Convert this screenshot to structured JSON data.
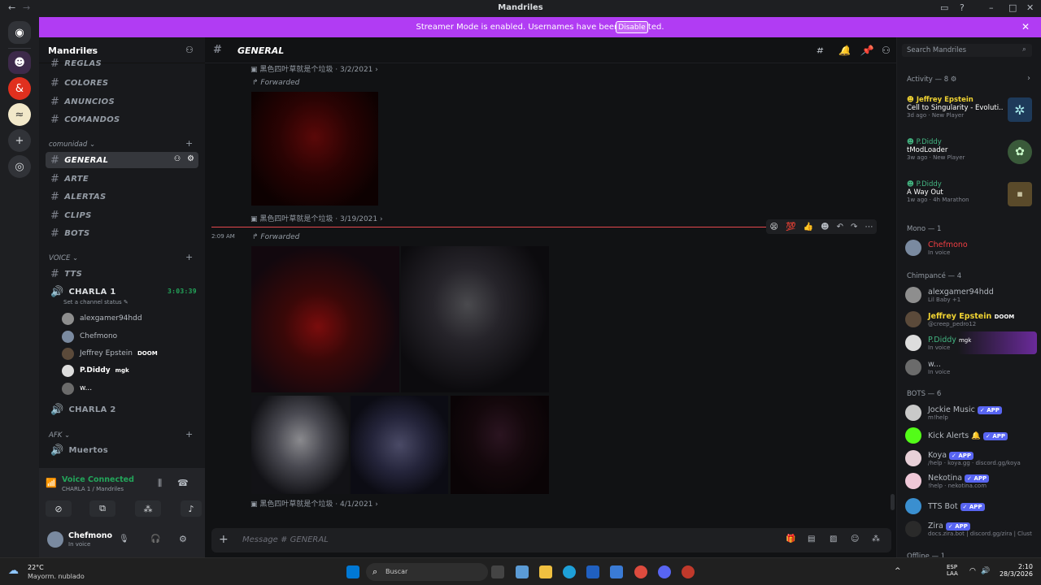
{
  "window": {
    "title": "Mandriles"
  },
  "banner": {
    "text": "Streamer Mode is enabled. Usernames have been truncated.",
    "button": "Disable"
  },
  "server": {
    "name": "Mandriles"
  },
  "channels": [
    {
      "name": "REGLAS"
    },
    {
      "name": "COLORES"
    },
    {
      "name": "ANUNCIOS"
    },
    {
      "name": "COMANDOS"
    }
  ],
  "categories": {
    "comunidad": "comunidad",
    "voice": "VOICE",
    "afk": "AFK"
  },
  "comunidad_channels": [
    {
      "name": "GENERAL"
    },
    {
      "name": "ARTE"
    },
    {
      "name": "ALERTAS"
    },
    {
      "name": "CLIPS"
    },
    {
      "name": "BOTS"
    }
  ],
  "voice": {
    "tts": "TTS",
    "charla1": "CHARLA 1",
    "charla1_time": "3:03:39",
    "status": "Set a channel status",
    "members": [
      {
        "name": "alexgamer94hdd"
      },
      {
        "name": "Chefmono"
      },
      {
        "name": "Jeffrey Epstein",
        "badge": "DOOM"
      },
      {
        "name": "P.Diddy",
        "badge": "mgk"
      },
      {
        "name": "w..."
      }
    ],
    "charla2": "CHARLA 2",
    "muertos": "Muertos"
  },
  "voice_panel": {
    "status": "Voice Connected",
    "location": "CHARLA 1 / Mandriles"
  },
  "user": {
    "name": "Chefmono",
    "status": "In voice"
  },
  "chat": {
    "channel": "GENERAL",
    "msg1_author": "黑色四叶草就是个垃圾",
    "msg1_date": "3/2/2021",
    "forwarded": "Forwarded",
    "msg2_date": "3/19/2021",
    "time": "2:09 AM",
    "msg3_date": "4/1/2021",
    "placeholder": "Message # GENERAL"
  },
  "search": {
    "placeholder": "Search Mandriles"
  },
  "activity": {
    "header": "Activity — 8",
    "items": [
      {
        "user": "Jeffrey Epstein",
        "game": "Cell to Singularity - Evoluti...",
        "time": "3d ago",
        "tag": "New Player"
      },
      {
        "user": "P.Diddy",
        "game": "tModLoader",
        "time": "3w ago",
        "tag": "New Player"
      },
      {
        "user": "P.Diddy",
        "game": "A Way Out",
        "time": "1w ago",
        "tag": "4h Marathon"
      }
    ]
  },
  "groups": {
    "mono": "Mono — 1",
    "chimpance": "Chimpancé — 4",
    "bots": "BOTS — 6",
    "offline": "Offline — 1"
  },
  "mono_members": [
    {
      "name": "Chefmono",
      "sub": "In voice"
    }
  ],
  "chimp_members": [
    {
      "name": "alexgamer94hdd",
      "sub": "Lil Baby +1"
    },
    {
      "name": "Jeffrey Epstein",
      "sub": "@creep_pedro12",
      "badge": "DOOM"
    },
    {
      "name": "P.Diddy",
      "sub": "In voice",
      "badge": "mgk"
    },
    {
      "name": "w...",
      "sub": "In voice"
    }
  ],
  "bot_members": [
    {
      "name": "Jockie Music",
      "sub": "m!help",
      "app": "APP"
    },
    {
      "name": "Kick Alerts",
      "sub": "",
      "app": "APP"
    },
    {
      "name": "Koya",
      "sub": "/help · koya.gg · discord.gg/koya",
      "app": "APP"
    },
    {
      "name": "Nekotina",
      "sub": "!help · nekotina.com",
      "app": "APP"
    },
    {
      "name": "TTS Bot",
      "sub": "",
      "app": "APP"
    },
    {
      "name": "Zira",
      "sub": "docs.zira.bot | discord.gg/zira | Clust",
      "app": "APP"
    }
  ],
  "taskbar": {
    "temp": "22°C",
    "weather": "Mayorm. nublado",
    "search": "Buscar",
    "lang": "ESP",
    "layout": "LAA",
    "time": "2:10",
    "date": "28/3/2026"
  },
  "colors": {
    "banner": "#b13cf3",
    "accent": "#5865f2",
    "voice_green": "#23a55a",
    "red_name": "#f23f43",
    "jeffrey": "#f0d332",
    "diddy": "#43b581"
  }
}
